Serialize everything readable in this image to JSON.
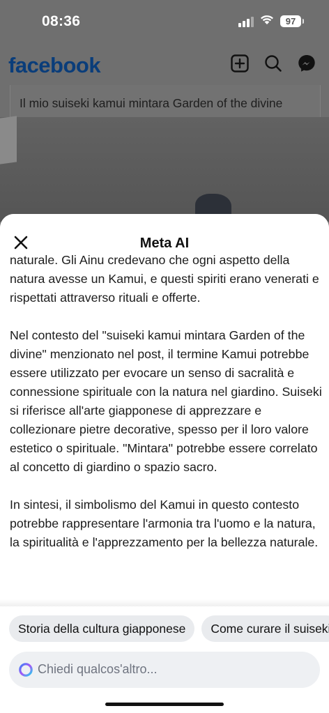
{
  "status_bar": {
    "time": "08:36",
    "battery": "97"
  },
  "header": {
    "logo": "facebook",
    "icons": [
      "plus-square-icon",
      "search-icon",
      "messenger-icon"
    ]
  },
  "post": {
    "caption": "Il mio suiseki kamui mintara Garden of the divine"
  },
  "sheet": {
    "title": "Meta AI",
    "close_icon": "close-icon",
    "paragraphs": [
      "naturale. Gli Ainu credevano che ogni aspetto della natura avesse un Kamui, e questi spiriti erano venerati e rispettati attraverso rituali e offerte.",
      "Nel contesto del \"suiseki kamui mintara Garden of the divine\" menzionato nel post, il termine Kamui potrebbe essere utilizzato per evocare un senso di sacralità e connessione spirituale con la natura nel giardino. Suiseki si riferisce all'arte giapponese di apprezzare e collezionare pietre decorative, spesso per il loro valore estetico o spirituale. \"Mintara\" potrebbe essere correlato al concetto di giardino o spazio sacro.",
      "In sintesi, il simbolismo del Kamui in questo contesto potrebbe rappresentare l'armonia tra l'uomo e la natura, la spiritualità e l'apprezzamento per la bellezza naturale."
    ],
    "suggestions": [
      "Storia della cultura giapponese",
      "Come curare il suiseki"
    ],
    "input": {
      "placeholder": "Chiedi qualcos'altro...",
      "icon": "meta-ai-ring-icon"
    }
  },
  "colors": {
    "facebook_blue": "#0866ff",
    "sheet_bg": "#ffffff",
    "chip_bg": "#e9ebee"
  }
}
